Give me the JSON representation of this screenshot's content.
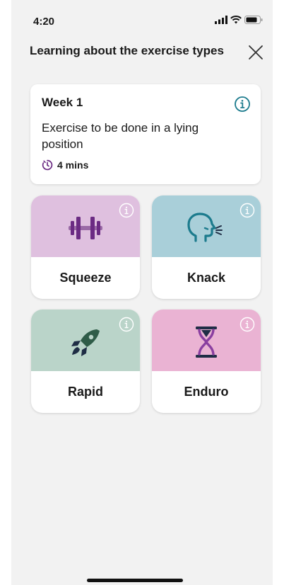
{
  "status_bar": {
    "time": "4:20",
    "icons": [
      "signal-icon",
      "wifi-icon",
      "battery-icon"
    ]
  },
  "header": {
    "title": "Learning about the exercise types",
    "close_icon": "close-icon"
  },
  "week_card": {
    "title": "Week 1",
    "description": "Exercise to be done in a lying position",
    "duration": "4 mins",
    "info_icon": "info-icon",
    "timer_icon": "timer-icon"
  },
  "exercises": [
    {
      "label": "Squeeze",
      "icon": "dumbbell-icon",
      "color": "#dfc0df"
    },
    {
      "label": "Knack",
      "icon": "cough-face-icon",
      "color": "#a9cfd9"
    },
    {
      "label": "Rapid",
      "icon": "rocket-icon",
      "color": "#bad4c9"
    },
    {
      "label": "Enduro",
      "icon": "hourglass-icon",
      "color": "#eab3d3"
    }
  ],
  "colors": {
    "accent_purple": "#6b2b83",
    "accent_teal": "#1c7b8d",
    "rocket_green": "#2f5c48",
    "icon_dark": "#1f2d45",
    "background": "#f2f2f2"
  }
}
